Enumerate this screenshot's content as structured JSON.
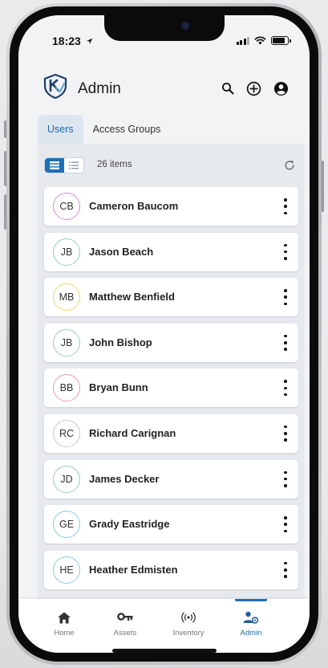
{
  "status_bar": {
    "time": "18:23"
  },
  "header": {
    "title": "Admin"
  },
  "tabs": [
    {
      "label": "Users",
      "active": true
    },
    {
      "label": "Access Groups",
      "active": false
    }
  ],
  "toolbar": {
    "item_count": "26 items"
  },
  "users": [
    {
      "initials": "CB",
      "name": "Cameron Baucom",
      "color": "#d58ad8"
    },
    {
      "initials": "JB",
      "name": "Jason Beach",
      "color": "#8fd1b5"
    },
    {
      "initials": "MB",
      "name": "Matthew Benfield",
      "color": "#ecd36a"
    },
    {
      "initials": "JB",
      "name": "John Bishop",
      "color": "#8fd1b5"
    },
    {
      "initials": "BB",
      "name": "Bryan Bunn",
      "color": "#ef9aa8"
    },
    {
      "initials": "RC",
      "name": "Richard Carignan",
      "color": "#c3c6cb"
    },
    {
      "initials": "JD",
      "name": "James Decker",
      "color": "#8fd1b5"
    },
    {
      "initials": "GE",
      "name": "Grady Eastridge",
      "color": "#86cbe3"
    },
    {
      "initials": "HE",
      "name": "Heather Edmisten",
      "color": "#86cbe3"
    }
  ],
  "bottom_nav": [
    {
      "label": "Home",
      "icon": "home-icon",
      "active": false
    },
    {
      "label": "Assets",
      "icon": "key-icon",
      "active": false
    },
    {
      "label": "Inventory",
      "icon": "radio-waves-icon",
      "active": false
    },
    {
      "label": "Admin",
      "icon": "user-settings-icon",
      "active": true
    }
  ],
  "colors": {
    "accent": "#1e6fb4",
    "background": "#f2f3f5",
    "panel": "#e6eaee"
  }
}
